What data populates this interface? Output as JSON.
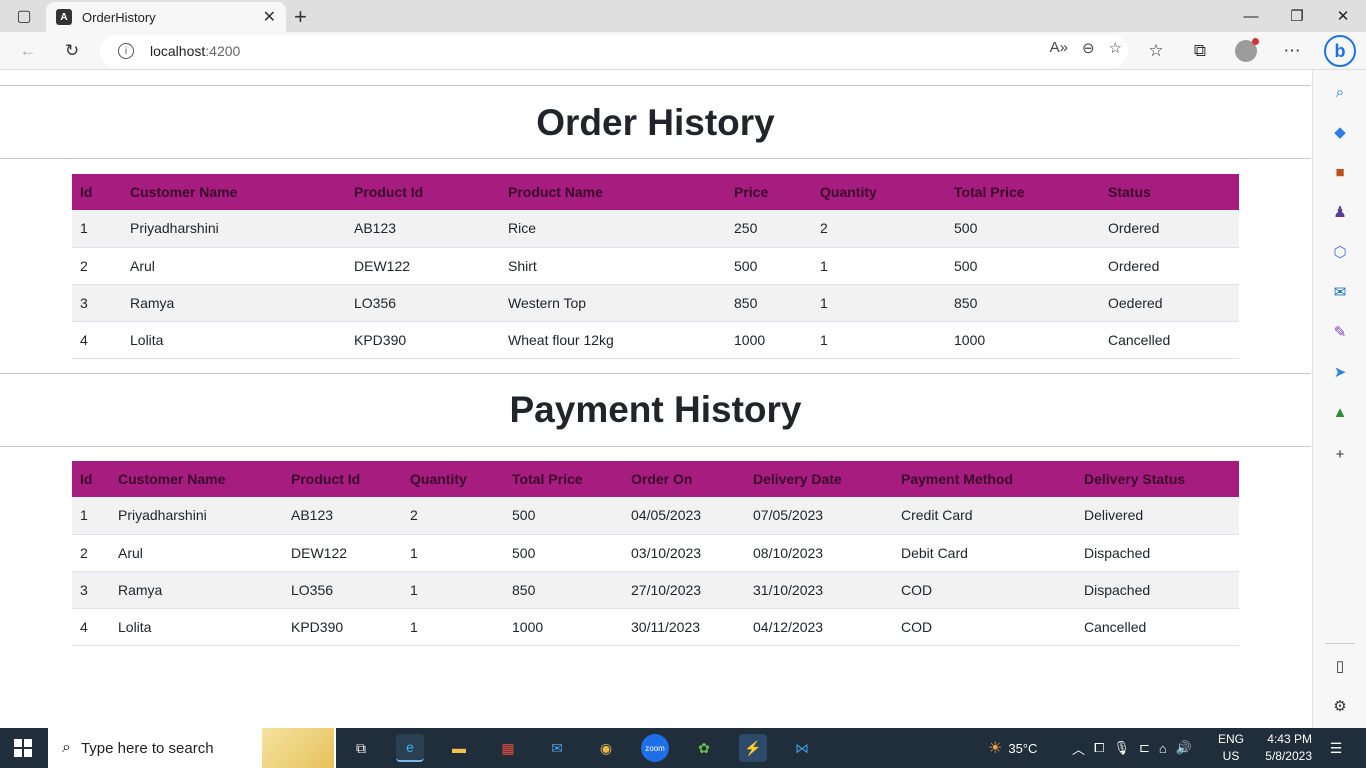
{
  "browser": {
    "tab_title": "OrderHistory",
    "address_host": "localhost",
    "address_port": ":4200"
  },
  "order_section": {
    "title": "Order History",
    "columns": [
      "Id",
      "Customer Name",
      "Product Id",
      "Product Name",
      "Price",
      "Quantity",
      "Total Price",
      "Status"
    ],
    "rows": [
      [
        "1",
        "Priyadharshini",
        "AB123",
        "Rice",
        "250",
        "2",
        "500",
        "Ordered"
      ],
      [
        "2",
        "Arul",
        "DEW122",
        "Shirt",
        "500",
        "1",
        "500",
        "Ordered"
      ],
      [
        "3",
        "Ramya",
        "LO356",
        "Western Top",
        "850",
        "1",
        "850",
        "Oedered"
      ],
      [
        "4",
        "Lolita",
        "KPD390",
        "Wheat flour 12kg",
        "1000",
        "1",
        "1000",
        "Cancelled"
      ]
    ]
  },
  "payment_section": {
    "title": "Payment History",
    "columns": [
      "Id",
      "Customer Name",
      "Product Id",
      "Quantity",
      "Total Price",
      "Order On",
      "Delivery Date",
      "Payment Method",
      "Delivery Status"
    ],
    "rows": [
      [
        "1",
        "Priyadharshini",
        "AB123",
        "2",
        "500",
        "04/05/2023",
        "07/05/2023",
        "Credit Card",
        "Delivered"
      ],
      [
        "2",
        "Arul",
        "DEW122",
        "1",
        "500",
        "03/10/2023",
        "08/10/2023",
        "Debit Card",
        "Dispached"
      ],
      [
        "3",
        "Ramya",
        "LO356",
        "1",
        "850",
        "27/10/2023",
        "31/10/2023",
        "COD",
        "Dispached"
      ],
      [
        "4",
        "Lolita",
        "KPD390",
        "1",
        "1000",
        "30/11/2023",
        "04/12/2023",
        "COD",
        "Cancelled"
      ]
    ]
  },
  "taskbar": {
    "search_placeholder": "Type here to search",
    "weather": "35°C",
    "lang_line1": "ENG",
    "lang_line2": "US",
    "time": "4:43 PM",
    "date": "5/8/2023"
  },
  "colors": {
    "table_header_bg": "#a61d7f",
    "table_header_text": "#3b0a2e",
    "striped_row": "#f2f2f2"
  }
}
